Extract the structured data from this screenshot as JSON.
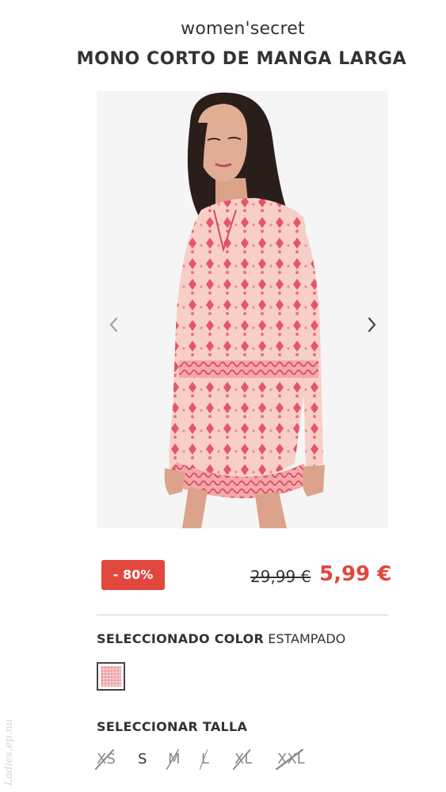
{
  "header": {
    "brand": "women'secret",
    "product_title": "MONO CORTO DE MANGA LARGA"
  },
  "gallery": {
    "image_alt": "Mono corto estampado",
    "prev_icon": "chevron-left-icon",
    "next_icon": "chevron-right-icon"
  },
  "pricing": {
    "discount_badge": "- 80%",
    "old_price": "29,99 €",
    "new_price": "5,99 €",
    "accent_color": "#e2473d"
  },
  "color_selector": {
    "label": "SELECCIONADO COLOR",
    "selected_value": "ESTAMPADO",
    "swatch_color": "#f4c6c6"
  },
  "size_selector": {
    "label": "SELECCIONAR TALLA",
    "sizes": [
      {
        "label": "XS",
        "available": false
      },
      {
        "label": "S",
        "available": true
      },
      {
        "label": "M",
        "available": false
      },
      {
        "label": "L",
        "available": false
      },
      {
        "label": "XL",
        "available": false
      },
      {
        "label": "XXL",
        "available": false
      }
    ]
  },
  "watermark": "Ladies.ep.nu"
}
